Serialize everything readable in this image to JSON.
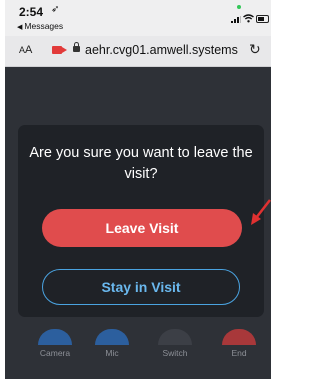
{
  "status_bar": {
    "time": "2:54",
    "location_arrow": "➶",
    "back_app": "Messages",
    "back_arrow": "◀"
  },
  "safari": {
    "text_size_label_small": "A",
    "text_size_label_large": "A",
    "url": "aehr.cvg01.amwell.systems",
    "reload_glyph": "↻"
  },
  "dialog": {
    "question": "Are you sure you want to leave the visit?",
    "leave_label": "Leave Visit",
    "stay_label": "Stay in Visit"
  },
  "controls": [
    {
      "label": "Camera"
    },
    {
      "label": "Mic"
    },
    {
      "label": "Switch"
    },
    {
      "label": "End"
    }
  ],
  "colors": {
    "leave": "#e04c4d",
    "stay_border": "#4aa3e0",
    "annotation_arrow": "#e03131"
  }
}
